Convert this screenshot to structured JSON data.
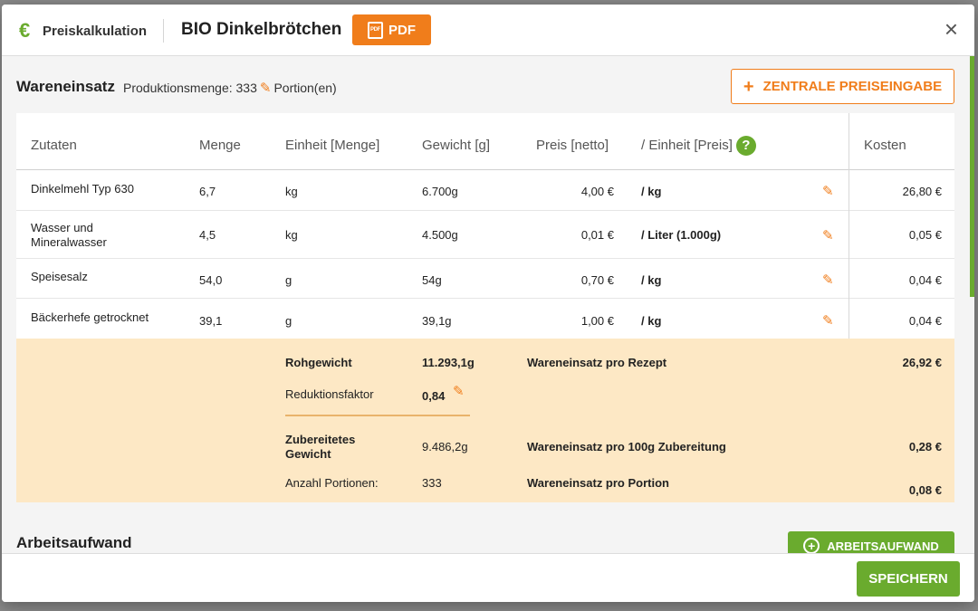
{
  "header": {
    "icon": "euro-icon",
    "icon_glyph": "€",
    "section_title": "Preiskalkulation",
    "recipe_name": "BIO Dinkelbrötchen",
    "pdf_icon_text": "PDF",
    "pdf_label": "PDF",
    "close_glyph": "×"
  },
  "wareneinsatz": {
    "title": "Wareneinsatz",
    "prod_label": "Produktionsmenge: 333",
    "prod_unit": "Portion(en)",
    "zentral_button": "ZENTRALE PREISEINGABE",
    "plus_glyph": "+",
    "pencil_glyph": "✎"
  },
  "table": {
    "headers": {
      "zutaten": "Zutaten",
      "menge": "Menge",
      "einheit": "Einheit [Menge]",
      "gewicht": "Gewicht [g]",
      "preis": "Preis [netto]",
      "einheit_preis": "/ Einheit [Preis]",
      "help": "?",
      "kosten": "Kosten"
    },
    "rows": [
      {
        "name": "Dinkelmehl Typ 630",
        "menge": "6,7",
        "einheit": "kg",
        "gewicht": "6.700g",
        "preis": "4,00 €",
        "einheit_preis": "/ kg",
        "kosten": "26,80 €"
      },
      {
        "name": "Wasser und Mineralwasser",
        "menge": "4,5",
        "einheit": "kg",
        "gewicht": "4.500g",
        "preis": "0,01 €",
        "einheit_preis": "/ Liter (1.000g)",
        "kosten": "0,05 €"
      },
      {
        "name": "Speisesalz",
        "menge": "54,0",
        "einheit": "g",
        "gewicht": "54g",
        "preis": "0,70 €",
        "einheit_preis": "/ kg",
        "kosten": "0,04 €"
      },
      {
        "name": "Bäckerhefe getrocknet",
        "menge": "39,1",
        "einheit": "g",
        "gewicht": "39,1g",
        "preis": "1,00 €",
        "einheit_preis": "/ kg",
        "kosten": "0,04 €"
      }
    ]
  },
  "summary": {
    "rohgewicht_label": "Rohgewicht",
    "rohgewicht_value": "11.293,1g",
    "we_rezept_label": "Wareneinsatz pro Rezept",
    "we_rezept_value": "26,92 €",
    "reduktion_label": "Reduktionsfaktor",
    "reduktion_value": "0,84",
    "zub_label": "Zubereitetes Gewicht",
    "zub_value": "9.486,2g",
    "we_100g_label": "Wareneinsatz pro 100g Zubereitung",
    "we_100g_value": "0,28 €",
    "portionen_label": "Anzahl Portionen:",
    "portionen_value": "333",
    "we_portion_label": "Wareneinsatz pro Portion",
    "we_portion_value": "0,08 €"
  },
  "arbeitsaufwand": {
    "title": "Arbeitsaufwand",
    "button": "ARBEITSAUFWAND",
    "plus_glyph": "+"
  },
  "footer": {
    "save": "SPEICHERN"
  },
  "colors": {
    "accent_orange": "#f07d1b",
    "accent_green": "#6aab2e",
    "summary_bg": "#fde8c5"
  }
}
